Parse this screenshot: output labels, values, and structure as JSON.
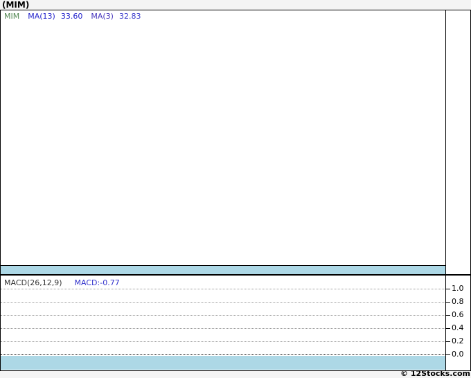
{
  "page": {
    "title": "(MIM)",
    "footer": "© 12Stocks.com",
    "colors": {
      "page_bg": "#f4f4f4",
      "panel_bg": "#ffffff",
      "border": "#000000",
      "band": "#ADD8E6",
      "gridline": "#999999",
      "zero_line": "#000000",
      "symbol_text": "#558855",
      "ma13_text": "#2323cc",
      "ma3_text": "#4433bb",
      "macd_value_text": "#3333cc"
    }
  },
  "price_panel": {
    "legend": {
      "symbol": "MIM",
      "ma13_label": "MA(13)",
      "ma13_value": "33.60",
      "ma3_label": "MA(3)",
      "ma3_value": "32.83"
    }
  },
  "macd_panel": {
    "legend": {
      "label": "MACD(26,12,9)",
      "value_label": "MACD:-0.77"
    },
    "axis_labels": [
      "1.0",
      "0.8",
      "0.6",
      "0.4",
      "0.2",
      "0.0"
    ]
  },
  "chart_data": [
    {
      "type": "line",
      "title": "(MIM)",
      "series": [
        {
          "name": "MIM",
          "values": []
        },
        {
          "name": "MA(13)",
          "last_value": 33.6,
          "values": []
        },
        {
          "name": "MA(3)",
          "last_value": 32.83,
          "values": []
        }
      ],
      "xlabel": "",
      "ylabel": "",
      "legend_position": "top-left",
      "grid": false,
      "notes": "price panel plot area is empty; light-blue horizontal band along panel bottom"
    },
    {
      "type": "line",
      "title": "MACD(26,12,9)",
      "series": [
        {
          "name": "MACD",
          "last_value": -0.77,
          "values": []
        }
      ],
      "xlabel": "",
      "ylabel": "",
      "ylim": [
        0.0,
        1.0
      ],
      "yticks": [
        1.0,
        0.8,
        0.6,
        0.4,
        0.2,
        0.0
      ],
      "legend_position": "top-left",
      "grid": true,
      "notes": "dotted horizontal gridlines every 0.2; zero line darker; light-blue band below 0.0"
    }
  ]
}
